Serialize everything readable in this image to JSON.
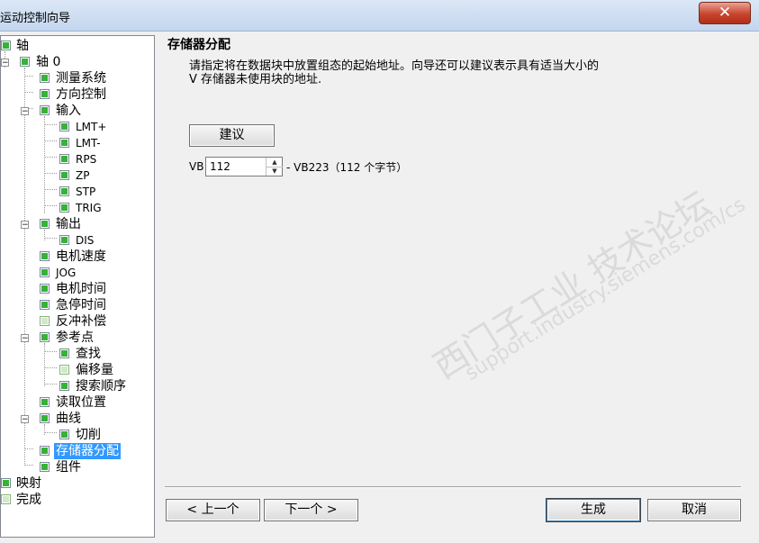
{
  "window": {
    "title": "运动控制向导",
    "close_glyph": "✕"
  },
  "tree": [
    {
      "label": "轴",
      "check": "checked",
      "expander": "none"
    },
    {
      "label": "轴 0",
      "check": "checked",
      "expander": "minus"
    },
    {
      "label": "测量系统",
      "check": "checked"
    },
    {
      "label": "方向控制",
      "check": "checked"
    },
    {
      "label": "输入",
      "check": "checked",
      "expander": "minus"
    },
    {
      "label": "LMT+",
      "check": "checked"
    },
    {
      "label": "LMT-",
      "check": "checked"
    },
    {
      "label": "RPS",
      "check": "checked"
    },
    {
      "label": "ZP",
      "check": "checked"
    },
    {
      "label": "STP",
      "check": "checked"
    },
    {
      "label": "TRIG",
      "check": "checked"
    },
    {
      "label": "输出",
      "check": "checked",
      "expander": "minus"
    },
    {
      "label": "DIS",
      "check": "checked"
    },
    {
      "label": "电机速度",
      "check": "checked"
    },
    {
      "label": "JOG",
      "check": "checked"
    },
    {
      "label": "电机时间",
      "check": "checked"
    },
    {
      "label": "急停时间",
      "check": "checked"
    },
    {
      "label": "反冲补偿",
      "check": "empty"
    },
    {
      "label": "参考点",
      "check": "checked",
      "expander": "minus"
    },
    {
      "label": "查找",
      "check": "checked"
    },
    {
      "label": "偏移量",
      "check": "empty"
    },
    {
      "label": "搜索顺序",
      "check": "checked"
    },
    {
      "label": "读取位置",
      "check": "checked"
    },
    {
      "label": "曲线",
      "check": "checked",
      "expander": "minus"
    },
    {
      "label": "切削",
      "check": "checked"
    },
    {
      "label": "存储器分配",
      "check": "checked",
      "selected": true
    },
    {
      "label": "组件",
      "check": "checked"
    },
    {
      "label": "映射",
      "check": "checked"
    },
    {
      "label": "完成",
      "check": "empty"
    }
  ],
  "panel": {
    "title": "存储器分配",
    "description_line1": "请指定将在数据块中放置组态的起始地址。向导还可以建议表示具有适当大小的",
    "description_line2": "V 存储器未使用块的地址.",
    "suggest_button": "建议",
    "vb_prefix": "VB",
    "vb_value": "112",
    "vb_suffix": "- VB223（112 个字节）"
  },
  "watermark": {
    "line1": "西门子工业 技术论坛",
    "line2": "support.industry.siemens.com/cs"
  },
  "footer": {
    "prev": "< 上一个",
    "next": "下一个 >",
    "generate": "生成",
    "cancel": "取消"
  }
}
